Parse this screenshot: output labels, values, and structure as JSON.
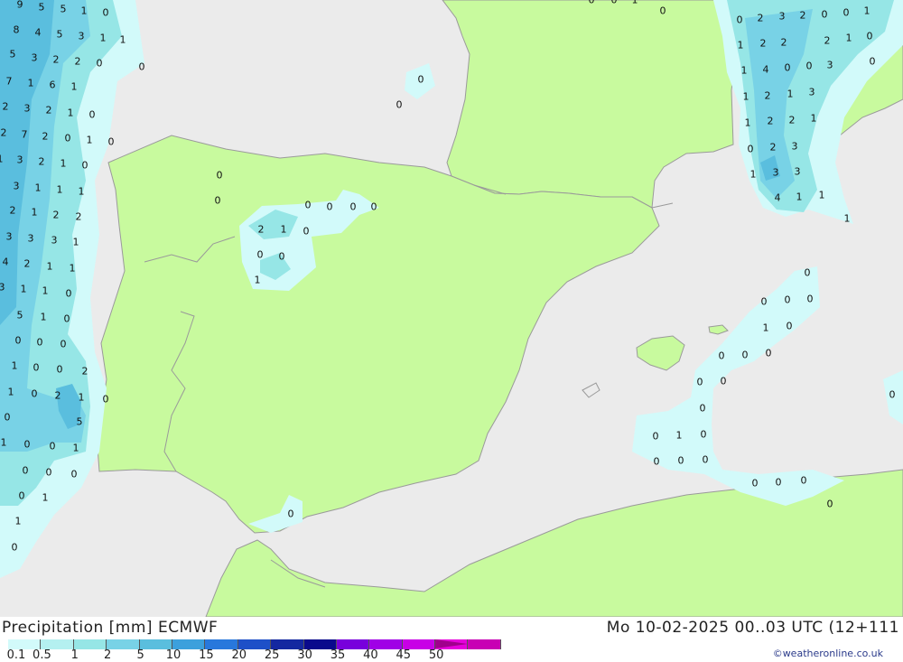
{
  "map": {
    "value_labels": [
      [
        "9",
        22,
        5
      ],
      [
        "5",
        46,
        8
      ],
      [
        "5",
        70,
        10
      ],
      [
        "1",
        93,
        12
      ],
      [
        "0",
        117,
        14
      ],
      [
        "8",
        18,
        33
      ],
      [
        "4",
        42,
        36
      ],
      [
        "5",
        66,
        38
      ],
      [
        "3",
        90,
        40
      ],
      [
        "1",
        114,
        42
      ],
      [
        "1",
        136,
        44
      ],
      [
        "5",
        14,
        60
      ],
      [
        "3",
        38,
        64
      ],
      [
        "2",
        62,
        66
      ],
      [
        "2",
        86,
        68
      ],
      [
        "0",
        110,
        70
      ],
      [
        "0",
        157,
        74
      ],
      [
        "7",
        10,
        90
      ],
      [
        "1",
        34,
        92
      ],
      [
        "6",
        58,
        94
      ],
      [
        "1",
        82,
        96
      ],
      [
        "2",
        6,
        118
      ],
      [
        "3",
        30,
        120
      ],
      [
        "2",
        54,
        122
      ],
      [
        "1",
        78,
        125
      ],
      [
        "0",
        102,
        127
      ],
      [
        "2",
        4,
        147
      ],
      [
        "7",
        27,
        149
      ],
      [
        "2",
        50,
        151
      ],
      [
        "0",
        75,
        153
      ],
      [
        "1",
        99,
        155
      ],
      [
        "0",
        123,
        157
      ],
      [
        "1",
        0,
        176
      ],
      [
        "3",
        22,
        177
      ],
      [
        "2",
        46,
        179
      ],
      [
        "1",
        70,
        181
      ],
      [
        "0",
        94,
        183
      ],
      [
        "3",
        18,
        206
      ],
      [
        "1",
        42,
        208
      ],
      [
        "1",
        66,
        210
      ],
      [
        "1",
        90,
        212
      ],
      [
        "2",
        14,
        233
      ],
      [
        "1",
        38,
        235
      ],
      [
        "2",
        62,
        238
      ],
      [
        "2",
        87,
        240
      ],
      [
        "3",
        10,
        262
      ],
      [
        "3",
        34,
        264
      ],
      [
        "3",
        60,
        266
      ],
      [
        "1",
        84,
        268
      ],
      [
        "4",
        6,
        290
      ],
      [
        "2",
        30,
        292
      ],
      [
        "1",
        55,
        295
      ],
      [
        "1",
        80,
        297
      ],
      [
        "3",
        2,
        318
      ],
      [
        "1",
        26,
        320
      ],
      [
        "1",
        50,
        322
      ],
      [
        "0",
        76,
        325
      ],
      [
        "5",
        22,
        349
      ],
      [
        "1",
        48,
        351
      ],
      [
        "0",
        74,
        353
      ],
      [
        "0",
        20,
        377
      ],
      [
        "0",
        44,
        379
      ],
      [
        "0",
        70,
        381
      ],
      [
        "1",
        16,
        405
      ],
      [
        "0",
        40,
        407
      ],
      [
        "0",
        66,
        409
      ],
      [
        "2",
        94,
        411
      ],
      [
        "1",
        12,
        434
      ],
      [
        "0",
        38,
        436
      ],
      [
        "2",
        64,
        438
      ],
      [
        "1",
        90,
        440
      ],
      [
        "0",
        117,
        442
      ],
      [
        "0",
        8,
        462
      ],
      [
        "5",
        88,
        467
      ],
      [
        "1",
        4,
        490
      ],
      [
        "0",
        30,
        492
      ],
      [
        "0",
        58,
        494
      ],
      [
        "1",
        84,
        496
      ],
      [
        "0",
        28,
        521
      ],
      [
        "0",
        54,
        523
      ],
      [
        "0",
        82,
        525
      ],
      [
        "0",
        24,
        549
      ],
      [
        "1",
        50,
        551
      ],
      [
        "1",
        20,
        577
      ],
      [
        "0",
        16,
        606
      ],
      [
        "0",
        466,
        88
      ],
      [
        "0",
        442,
        116
      ],
      [
        "0",
        243,
        194
      ],
      [
        "0",
        241,
        222
      ],
      [
        "0",
        341,
        227
      ],
      [
        "0",
        365,
        229
      ],
      [
        "0",
        391,
        229
      ],
      [
        "0",
        414,
        229
      ],
      [
        "2",
        289,
        254
      ],
      [
        "1",
        314,
        254
      ],
      [
        "0",
        339,
        256
      ],
      [
        "0",
        288,
        282
      ],
      [
        "0",
        312,
        284
      ],
      [
        "1",
        285,
        310
      ],
      [
        "0",
        322,
        569
      ],
      [
        "0",
        655,
        0
      ],
      [
        "0",
        680,
        0
      ],
      [
        "1",
        703,
        0
      ],
      [
        "0",
        734,
        12
      ],
      [
        "0",
        819,
        22
      ],
      [
        "2",
        842,
        20
      ],
      [
        "3",
        866,
        18
      ],
      [
        "2",
        889,
        17
      ],
      [
        "0",
        913,
        16
      ],
      [
        "0",
        937,
        14
      ],
      [
        "1",
        960,
        12
      ],
      [
        "1",
        820,
        50
      ],
      [
        "2",
        845,
        48
      ],
      [
        "2",
        868,
        47
      ],
      [
        "2",
        916,
        45
      ],
      [
        "1",
        940,
        42
      ],
      [
        "0",
        963,
        40
      ],
      [
        "1",
        824,
        78
      ],
      [
        "4",
        848,
        77
      ],
      [
        "0",
        872,
        75
      ],
      [
        "0",
        896,
        73
      ],
      [
        "3",
        919,
        72
      ],
      [
        "0",
        966,
        68
      ],
      [
        "1",
        826,
        107
      ],
      [
        "2",
        850,
        106
      ],
      [
        "1",
        875,
        104
      ],
      [
        "3",
        899,
        102
      ],
      [
        "1",
        828,
        136
      ],
      [
        "2",
        853,
        134
      ],
      [
        "2",
        877,
        133
      ],
      [
        "1",
        901,
        131
      ],
      [
        "0",
        831,
        165
      ],
      [
        "2",
        856,
        163
      ],
      [
        "3",
        880,
        162
      ],
      [
        "1",
        834,
        193
      ],
      [
        "3",
        859,
        191
      ],
      [
        "3",
        883,
        190
      ],
      [
        "4",
        861,
        219
      ],
      [
        "1",
        885,
        218
      ],
      [
        "1",
        910,
        216
      ],
      [
        "1",
        938,
        242
      ],
      [
        "0",
        894,
        302
      ],
      [
        "0",
        846,
        334
      ],
      [
        "0",
        872,
        332
      ],
      [
        "0",
        897,
        331
      ],
      [
        "1",
        848,
        363
      ],
      [
        "0",
        874,
        361
      ],
      [
        "0",
        799,
        394
      ],
      [
        "0",
        825,
        393
      ],
      [
        "0",
        851,
        391
      ],
      [
        "0",
        775,
        423
      ],
      [
        "0",
        801,
        422
      ],
      [
        "0",
        778,
        452
      ],
      [
        "0",
        726,
        483
      ],
      [
        "1",
        752,
        482
      ],
      [
        "0",
        779,
        481
      ],
      [
        "0",
        727,
        511
      ],
      [
        "0",
        754,
        510
      ],
      [
        "0",
        781,
        509
      ],
      [
        "0",
        836,
        535
      ],
      [
        "0",
        862,
        534
      ],
      [
        "0",
        890,
        532
      ],
      [
        "0",
        919,
        558
      ],
      [
        "0",
        988,
        437
      ]
    ]
  },
  "footer": {
    "title": "Precipitation [mm] ECMWF",
    "run_info": "Mo 10-02-2025 00..03 UTC (12+111",
    "credit": "©weatheronline.co.uk",
    "scale_colors": [
      "#d2fafa",
      "#b4f0f0",
      "#96e6e6",
      "#78d2e6",
      "#5abede",
      "#3ca0dc",
      "#2878dc",
      "#1e50c8",
      "#1428a0",
      "#0a0a8c",
      "#7800dc",
      "#a000e6",
      "#c800e6",
      "#e600dc",
      "#c800b4"
    ],
    "scale_ticks": [
      "0.1",
      "0.5",
      "1",
      "2",
      "5",
      "10",
      "15",
      "20",
      "25",
      "30",
      "35",
      "40",
      "45",
      "50"
    ]
  }
}
